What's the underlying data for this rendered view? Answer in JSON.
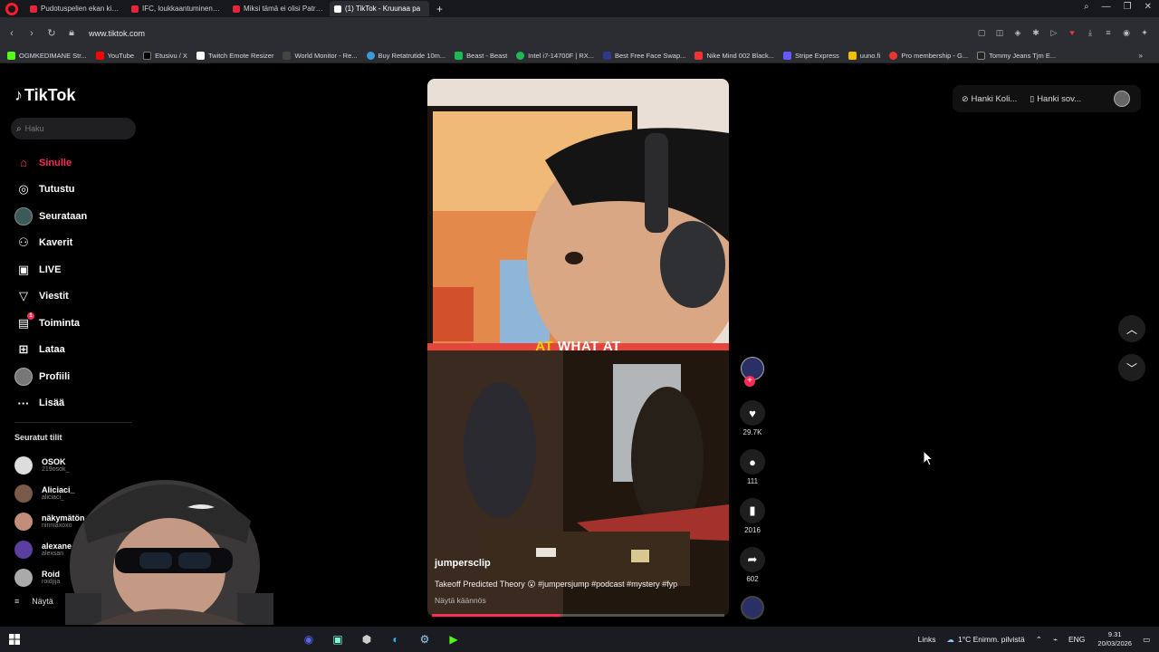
{
  "browser": {
    "tabs": [
      {
        "label": "Pudotuspelien ekan kierros",
        "color": "#e5243b"
      },
      {
        "label": "IFC, loukkaantuminen & V",
        "color": "#e5243b"
      },
      {
        "label": "Miksi tämä ei olisi Patrik E",
        "color": "#e5243b"
      },
      {
        "label": "(1) TikTok - Kruunaa pa",
        "color": "#ffffff"
      }
    ],
    "new_tab": "+",
    "url": "www.tiktok.com",
    "bookmarks": [
      {
        "label": "OGMKEDIMANE Str...",
        "color": "#53fc18"
      },
      {
        "label": "YouTube",
        "color": "#ff0000"
      },
      {
        "label": "Etusivu / X",
        "color": "#000000"
      },
      {
        "label": "Twitch Emote Resizer",
        "color": "#ffffff"
      },
      {
        "label": "World Monitor - Re...",
        "color": "#444444"
      },
      {
        "label": "Buy Retatrutide 10m...",
        "color": "#3a9ad9"
      },
      {
        "label": "Beast - Beast",
        "color": "#1db954"
      },
      {
        "label": "Intel i7-14700F | RX...",
        "color": "#1db954"
      },
      {
        "label": "Best Free Face Swap...",
        "color": "#2d3a8c"
      },
      {
        "label": "Nike Mind 002 Black...",
        "color": "#e33"
      },
      {
        "label": "Stripe Express",
        "color": "#635bff"
      },
      {
        "label": "uuno.fi",
        "color": "#f0c000"
      },
      {
        "label": "Pro membership - G...",
        "color": "#e33"
      },
      {
        "label": "Tommy Jeans Tjm E...",
        "color": "#222"
      }
    ]
  },
  "tiktok": {
    "logo": "TikTok",
    "search_placeholder": "Haku",
    "nav": [
      {
        "label": "Sinulle",
        "icon": "home-icon",
        "glyph": "⌂"
      },
      {
        "label": "Tutustu",
        "icon": "compass-icon",
        "glyph": "◎"
      },
      {
        "label": "Seurataan",
        "icon": "following-avatar-icon",
        "glyph": ""
      },
      {
        "label": "Kaverit",
        "icon": "friends-icon",
        "glyph": "⚇"
      },
      {
        "label": "LIVE",
        "icon": "live-icon",
        "glyph": "▣"
      },
      {
        "label": "Viestit",
        "icon": "messages-icon",
        "glyph": "▽"
      },
      {
        "label": "Toiminta",
        "icon": "activity-icon",
        "glyph": "▤",
        "badge": "1"
      },
      {
        "label": "Lataa",
        "icon": "upload-icon",
        "glyph": "⊞"
      },
      {
        "label": "Profiili",
        "icon": "profile-avatar-icon",
        "glyph": ""
      },
      {
        "label": "Lisää",
        "icon": "more-icon",
        "glyph": "···"
      }
    ],
    "followed_title": "Seuratut tilit",
    "followed": [
      {
        "name": "OSOK",
        "handle": "219osok_"
      },
      {
        "name": "Aliciaci_",
        "handle": "aliciaci_"
      },
      {
        "name": "näkymätön",
        "handle": "ninniaxoxo"
      },
      {
        "name": "alexane",
        "handle": "alexsan"
      },
      {
        "name": "Roid",
        "handle": "roidjija"
      }
    ],
    "show_more": "Näytä",
    "top_right": {
      "coins_label": "Hanki Koli...",
      "app_label": "Hanki sov..."
    }
  },
  "video": {
    "caption_word_1": "AT",
    "caption_word_2": "WHAT AT",
    "author": "jumpersclip",
    "description": "Takeoff Predicted Theory 😮 #jumpersjump #podcast #mystery #fyp",
    "translate": "Näytä käännös",
    "progress": 0.44,
    "likes": "29.7K",
    "comments": "111",
    "saves": "2016",
    "shares": "602"
  },
  "taskbar": {
    "links": "Links",
    "weather": "1°C  Enimm. pilvistä",
    "lang": "ENG",
    "time": "9.31",
    "date": "20/03/2026"
  },
  "colors": {
    "accent": "#fe2c55",
    "caption_yellow": "#f8d200"
  }
}
